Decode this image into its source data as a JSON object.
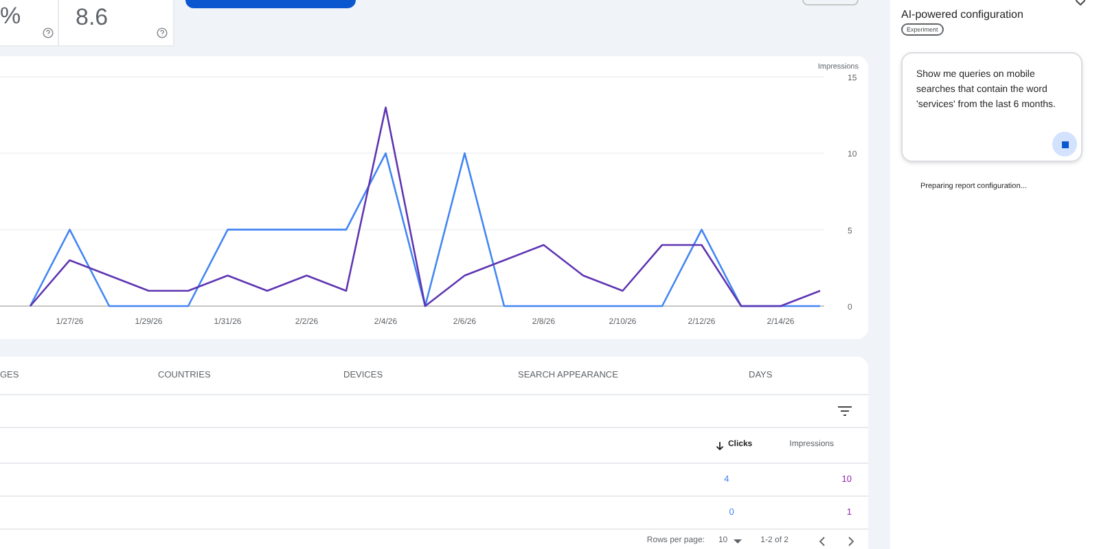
{
  "metrics": [
    {
      "value": "%"
    },
    {
      "value": "8.6"
    }
  ],
  "chart": {
    "chart_data": {
      "type": "line",
      "categories": [
        null,
        "1/27/26",
        null,
        "1/29/26",
        null,
        "1/31/26",
        null,
        "2/2/26",
        null,
        "2/4/26",
        null,
        "2/6/26",
        null,
        "2/8/26",
        null,
        "2/10/26",
        null,
        "2/12/26",
        null,
        "2/14/26",
        null
      ],
      "ylabel": "Impressions",
      "ylim": [
        0,
        15
      ],
      "yticks": [
        0,
        5,
        10,
        15
      ],
      "series": [
        {
          "color": "#4285f4",
          "values": [
            0,
            5,
            0,
            0,
            0,
            5,
            5,
            5,
            5,
            10,
            0,
            10,
            0,
            0,
            0,
            0,
            0,
            5,
            0,
            0,
            0
          ]
        },
        {
          "color": "#5e35b1",
          "values": [
            0,
            3,
            2,
            1,
            1,
            2,
            1,
            2,
            1,
            13,
            0,
            2,
            3,
            4,
            2,
            1,
            4,
            4,
            0,
            0,
            1
          ]
        }
      ]
    }
  },
  "table": {
    "tabs": [
      {
        "label": "GES",
        "selected": false
      },
      {
        "label": "COUNTRIES",
        "selected": false
      },
      {
        "label": "DEVICES",
        "selected": false
      },
      {
        "label": "SEARCH APPEARANCE",
        "selected": false
      },
      {
        "label": "DAYS",
        "selected": false
      }
    ],
    "columns": [
      {
        "label": "Clicks",
        "sorted": true
      },
      {
        "label": "Impressions",
        "sorted": false
      }
    ],
    "rows": [
      {
        "clicks": "4",
        "impressions": "10"
      },
      {
        "clicks": "0",
        "impressions": "1"
      }
    ],
    "footer": {
      "rows_per_page_label": "Rows per page:",
      "rows_per_page": "10",
      "range": "1-2 of 2"
    }
  },
  "panel": {
    "title": "AI-powered configuration",
    "badge": "Experiment",
    "prompt": "Show me queries on mobile searches that contain the word 'services' from the last 6 months.",
    "status": "Preparing report configuration..."
  }
}
